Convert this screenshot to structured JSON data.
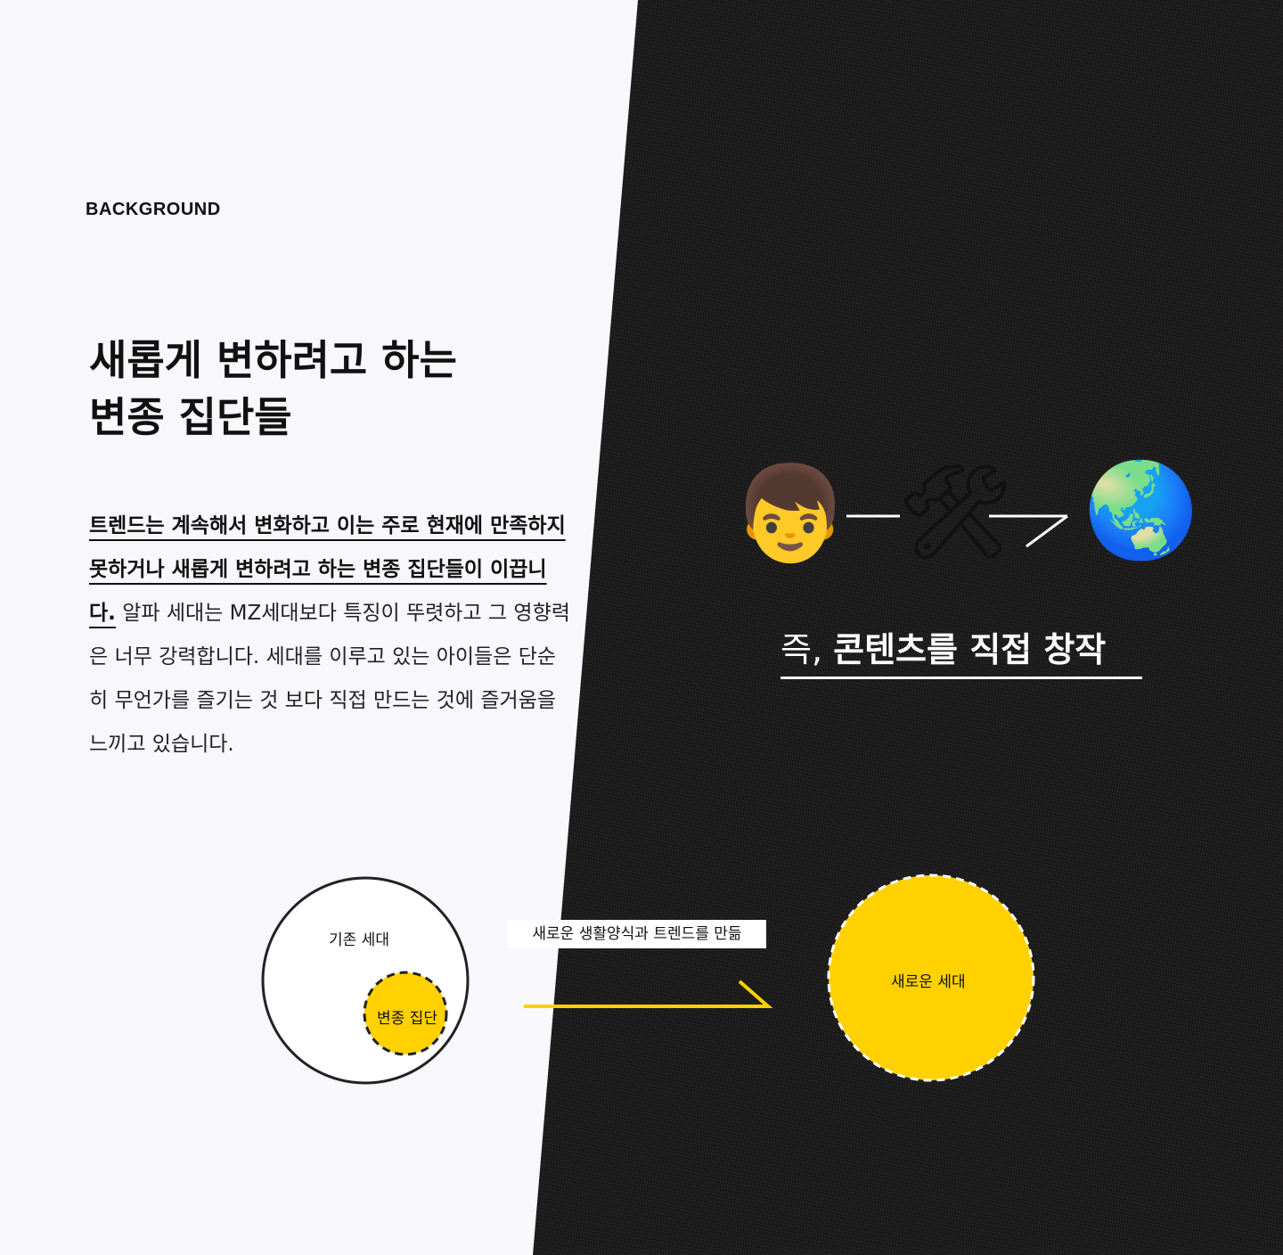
{
  "section_label": "BACKGROUND",
  "headline": {
    "line1": "새롭게 변하려고 하는",
    "line2": "변종 집단들"
  },
  "body": {
    "emphasis": "트렌드는 계속해서 변화하고 이는 주로 현재에 만족하지 못하거나 새롭게 변하려고 하는 변종 집단들이 이끕니다.",
    "rest": " 알파 세대는 MZ세대보다 특징이 뚜렷하고 그 영향력은 너무 강력합니다. 세대를 이루고 있는 아이들은 단순히 무언가를 즐기는 것 보다 직접 만드는 것에 즐거움을 느끼고 있습니다."
  },
  "flow": {
    "icons": [
      "boy-emoji",
      "hammer-wrench-emoji",
      "globe-emoji"
    ],
    "boy": "👦",
    "tools": "🛠",
    "globe": "🌏",
    "tagline_prefix": "즉, ",
    "tagline_emphasis": "콘텐츠를 직접 창작"
  },
  "diagram": {
    "outer_label": "기존 세대",
    "inner_label": "변종 집단",
    "arrow_note": "새로운 생활양식과 트렌드를 만듦",
    "result_label": "새로운 세대",
    "accent_color": "#ffd100",
    "line_color": "#222222"
  }
}
